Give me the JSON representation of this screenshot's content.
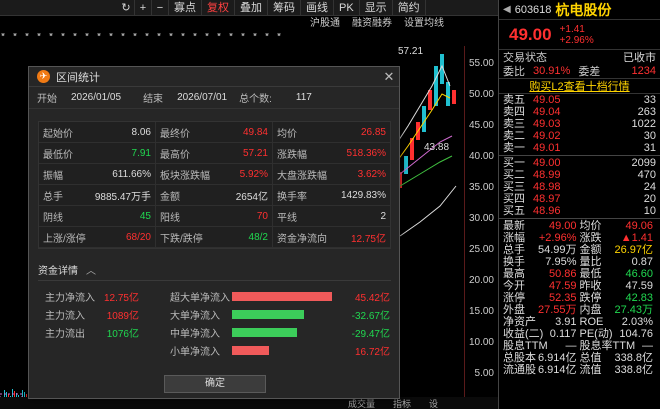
{
  "toolbar": {
    "items": [
      "↻",
      "+",
      "−",
      "寡点",
      "复权",
      "叠加",
      "筹码",
      "画线",
      "PK",
      "显示",
      "简约"
    ],
    "active_index": 4
  },
  "subbar": [
    "沪股通",
    "融资融券",
    "设置均线"
  ],
  "stars": "* *  * *  * *  *   *  *  *  *   *  *   *   *  *  *   *  *   *  *   *   *  *",
  "price_axis": [
    "55.00",
    "50.00",
    "45.00",
    "40.00",
    "35.00",
    "30.00",
    "25.00",
    "20.00",
    "15.00",
    "10.00",
    "5.00"
  ],
  "chart_labels": {
    "high": "57.21",
    "mid": "43.88"
  },
  "bottom_bar": [
    "成交量",
    "指标",
    "设"
  ],
  "quote": {
    "code": "603618",
    "name": "杭电股份",
    "price": "49.00",
    "change": "+1.41",
    "change_pct": "+2.96%",
    "status_label": "交易状态",
    "status_value": "已收市",
    "weibi_label": "委比",
    "weibi_value": "30.91%",
    "weicha_label": "委差",
    "weicha_value": "1234",
    "l2_link": "购买L2查看十档行情",
    "asks": [
      {
        "label": "卖五",
        "price": "49.05",
        "vol": "33"
      },
      {
        "label": "卖四",
        "price": "49.04",
        "vol": "263"
      },
      {
        "label": "卖三",
        "price": "49.03",
        "vol": "1022"
      },
      {
        "label": "卖二",
        "price": "49.02",
        "vol": "30"
      },
      {
        "label": "卖一",
        "price": "49.01",
        "vol": "31"
      }
    ],
    "bids": [
      {
        "label": "买一",
        "price": "49.00",
        "vol": "2099"
      },
      {
        "label": "买二",
        "price": "48.99",
        "vol": "470"
      },
      {
        "label": "买三",
        "price": "48.98",
        "vol": "24"
      },
      {
        "label": "买四",
        "price": "48.97",
        "vol": "20"
      },
      {
        "label": "买五",
        "price": "48.96",
        "vol": "10"
      }
    ],
    "stats": [
      {
        "l1": "最新",
        "v1": "49.00",
        "c1": "red",
        "l2": "均价",
        "v2": "49.06",
        "c2": "red"
      },
      {
        "l1": "涨幅",
        "v1": "+2.96%",
        "c1": "red",
        "l2": "涨跌",
        "v2": "▲1.41",
        "c2": "red"
      },
      {
        "l1": "总手",
        "v1": "54.99万",
        "c1": "white",
        "l2": "金额",
        "v2": "26.97亿",
        "c2": "yellow"
      },
      {
        "l1": "换手",
        "v1": "7.95%",
        "c1": "white",
        "l2": "量比",
        "v2": "0.87",
        "c2": "white"
      },
      {
        "l1": "最高",
        "v1": "50.86",
        "c1": "red",
        "l2": "最低",
        "v2": "46.60",
        "c2": "green"
      },
      {
        "l1": "今开",
        "v1": "47.59",
        "c1": "red",
        "l2": "昨收",
        "v2": "47.59",
        "c2": "white"
      },
      {
        "l1": "涨停",
        "v1": "52.35",
        "c1": "red",
        "l2": "跌停",
        "v2": "42.83",
        "c2": "green"
      },
      {
        "l1": "外盘",
        "v1": "27.55万",
        "c1": "red",
        "l2": "内盘",
        "v2": "27.43万",
        "c2": "green"
      },
      {
        "l1": "净资产",
        "v1": "3.91",
        "c1": "white",
        "l2": "ROE",
        "v2": "2.03%",
        "c2": "white"
      },
      {
        "l1": "收益(二)",
        "v1": "0.117",
        "c1": "white",
        "l2": "PE(动)",
        "v2": "104.76",
        "c2": "white"
      },
      {
        "l1": "股息TTM",
        "v1": "—",
        "c1": "white",
        "l2": "股息率TTM",
        "v2": "—",
        "c2": "white"
      },
      {
        "l1": "总股本",
        "v1": "6.914亿",
        "c1": "white",
        "l2": "总值",
        "v2": "338.8亿",
        "c2": "white"
      },
      {
        "l1": "流通股",
        "v1": "6.914亿",
        "c1": "white",
        "l2": "流值",
        "v2": "338.8亿",
        "c2": "white"
      }
    ]
  },
  "dialog": {
    "title": "区间统计",
    "start_label": "开始",
    "start_value": "2026/01/05",
    "end_label": "结束",
    "end_value": "2026/07/01",
    "count_label": "总个数:",
    "count_value": "117",
    "grid": [
      [
        {
          "label": "起始价",
          "value": "8.06",
          "color": "white"
        },
        {
          "label": "最终价",
          "value": "49.84",
          "color": "red"
        },
        {
          "label": "均价",
          "value": "26.85",
          "color": "red"
        }
      ],
      [
        {
          "label": "最低价",
          "value": "7.91",
          "color": "green"
        },
        {
          "label": "最高价",
          "value": "57.21",
          "color": "red"
        },
        {
          "label": "涨跌幅",
          "value": "518.36%",
          "color": "red"
        }
      ],
      [
        {
          "label": "振幅",
          "value": "611.66%",
          "color": "white"
        },
        {
          "label": "板块涨跌幅",
          "value": "5.92%",
          "color": "red"
        },
        {
          "label": "大盘涨跌幅",
          "value": "3.62%",
          "color": "red"
        }
      ],
      [
        {
          "label": "总手",
          "value": "9885.47万手",
          "color": "white"
        },
        {
          "label": "金额",
          "value": "2654亿",
          "color": "white"
        },
        {
          "label": "换手率",
          "value": "1429.83%",
          "color": "white"
        }
      ],
      [
        {
          "label": "阴线",
          "value": "45",
          "color": "green"
        },
        {
          "label": "阳线",
          "value": "70",
          "color": "red"
        },
        {
          "label": "平线",
          "value": "2",
          "color": "white"
        }
      ],
      [
        {
          "label": "上涨/涨停",
          "value": "68/20",
          "color": "red"
        },
        {
          "label": "下跌/跌停",
          "value": "48/2",
          "color": "green"
        },
        {
          "label": "资金净流向",
          "value": "12.75亿",
          "color": "red"
        }
      ]
    ],
    "fund_title": "资金详情",
    "fund_left": [
      {
        "label": "主力净流入",
        "value": "12.75亿",
        "color": "red"
      },
      {
        "label": "主力流入",
        "value": "1089亿",
        "color": "red"
      },
      {
        "label": "主力流出",
        "value": "1076亿",
        "color": "green"
      }
    ],
    "fund_right": [
      {
        "label": "超大单净流入",
        "value": "45.42亿",
        "color": "red",
        "level": 1.0
      },
      {
        "label": "大单净流入",
        "value": "-32.67亿",
        "color": "green",
        "level": 0.72
      },
      {
        "label": "中单净流入",
        "value": "-29.47亿",
        "color": "green",
        "level": 0.65
      },
      {
        "label": "小单净流入",
        "value": "16.72亿",
        "color": "red",
        "level": 0.37
      }
    ],
    "ok_label": "确定"
  },
  "colors": {
    "red": "#ff3030",
    "green": "#20d850",
    "yellow": "#ffd400",
    "bar_red": "#f05a5a",
    "bar_green": "#3ccd5a"
  }
}
